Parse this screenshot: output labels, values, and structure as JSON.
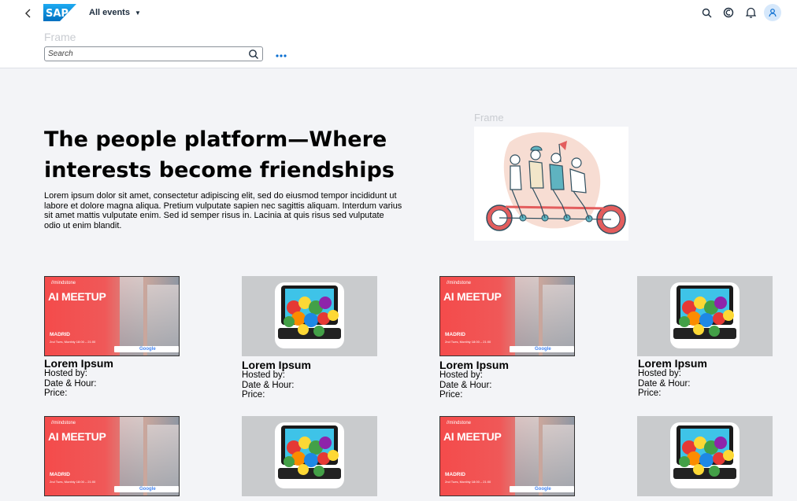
{
  "header": {
    "brand": "SAP",
    "events_menu_label": "All events",
    "frame_label": "Frame",
    "search_placeholder": "Search",
    "search_value": ""
  },
  "icons": {
    "back": "chevron-left-icon",
    "search": "search-icon",
    "copilot": "copilot-icon",
    "notifications": "bell-icon",
    "user": "user-icon",
    "overflow": "overflow-icon"
  },
  "hero": {
    "title": "The people platform—Where interests become friendships",
    "text": "Lorem ipsum dolor sit amet, consectetur adipiscing elit, sed do eiusmod tempor incididunt ut labore et dolore magna aliqua. Pretium vulputate sapien nec sagittis aliquam. Interdum varius sit amet mattis vulputate enim. Sed id semper risus in. Lacinia at quis risus sed vulputate odio ut enim blandit.",
    "image_frame_label": "Frame"
  },
  "meetup_banner": {
    "brand": "//mindstone",
    "title": "AI MEETUP",
    "city": "MADRID",
    "when": "2nd Tues, Monthly 18:00 – 21:00",
    "partner": "Google"
  },
  "cards": [
    {
      "title": "Lorem Ipsum",
      "hosted": "Hosted by:",
      "date": "Date & Hour:",
      "price": "Price:"
    },
    {
      "title": "Lorem Ipsum",
      "hosted": "Hosted by:",
      "date": "Date & Hour:",
      "price": "Price:"
    },
    {
      "title": "Lorem Ipsum",
      "hosted": "Hosted by:",
      "date": "Date & Hour:",
      "price": "Price:"
    },
    {
      "title": "Lorem Ipsum",
      "hosted": "Hosted by:",
      "date": "Date & Hour:",
      "price": "Price:"
    }
  ],
  "colors": {
    "accent": "#0a6ed1",
    "page_bg": "#f3f4f7",
    "banner_red": "#f44b4b",
    "thumb_grey": "#c9cbcd"
  }
}
